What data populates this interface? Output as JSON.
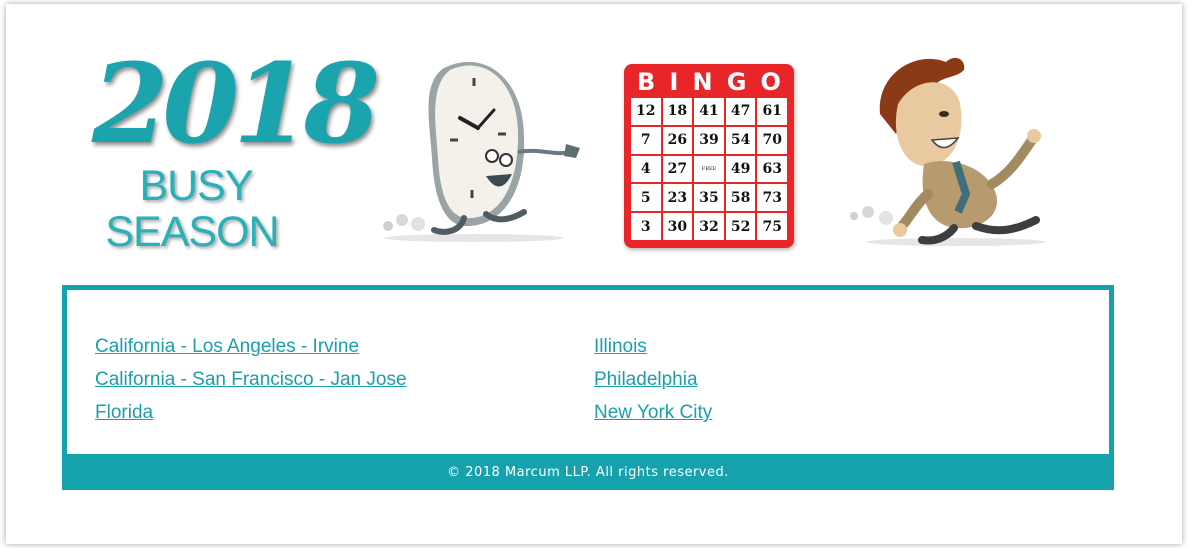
{
  "logo": {
    "year": "2018",
    "line1": "BUSY",
    "line2": "SEASON"
  },
  "illustrations": {
    "clock": "running-clock-icon",
    "man": "running-man-icon"
  },
  "bingo": {
    "letters": [
      "B",
      "I",
      "N",
      "G",
      "O"
    ],
    "rows": [
      [
        "12",
        "18",
        "41",
        "47",
        "61"
      ],
      [
        "7",
        "26",
        "39",
        "54",
        "70"
      ],
      [
        "4",
        "27",
        "FREE",
        "49",
        "63"
      ],
      [
        "5",
        "23",
        "35",
        "58",
        "73"
      ],
      [
        "3",
        "30",
        "32",
        "52",
        "75"
      ]
    ]
  },
  "links": {
    "left": [
      "California - Los Angeles - Irvine",
      "California - San Francisco - Jan Jose",
      "Florida"
    ],
    "right": [
      "Illinois",
      "Philadelphia",
      "New York City"
    ]
  },
  "footer": {
    "copyright": "© 2018 Marcum LLP. All rights reserved."
  },
  "colors": {
    "teal": "#16a2ad",
    "bingo_red": "#e8262a"
  }
}
